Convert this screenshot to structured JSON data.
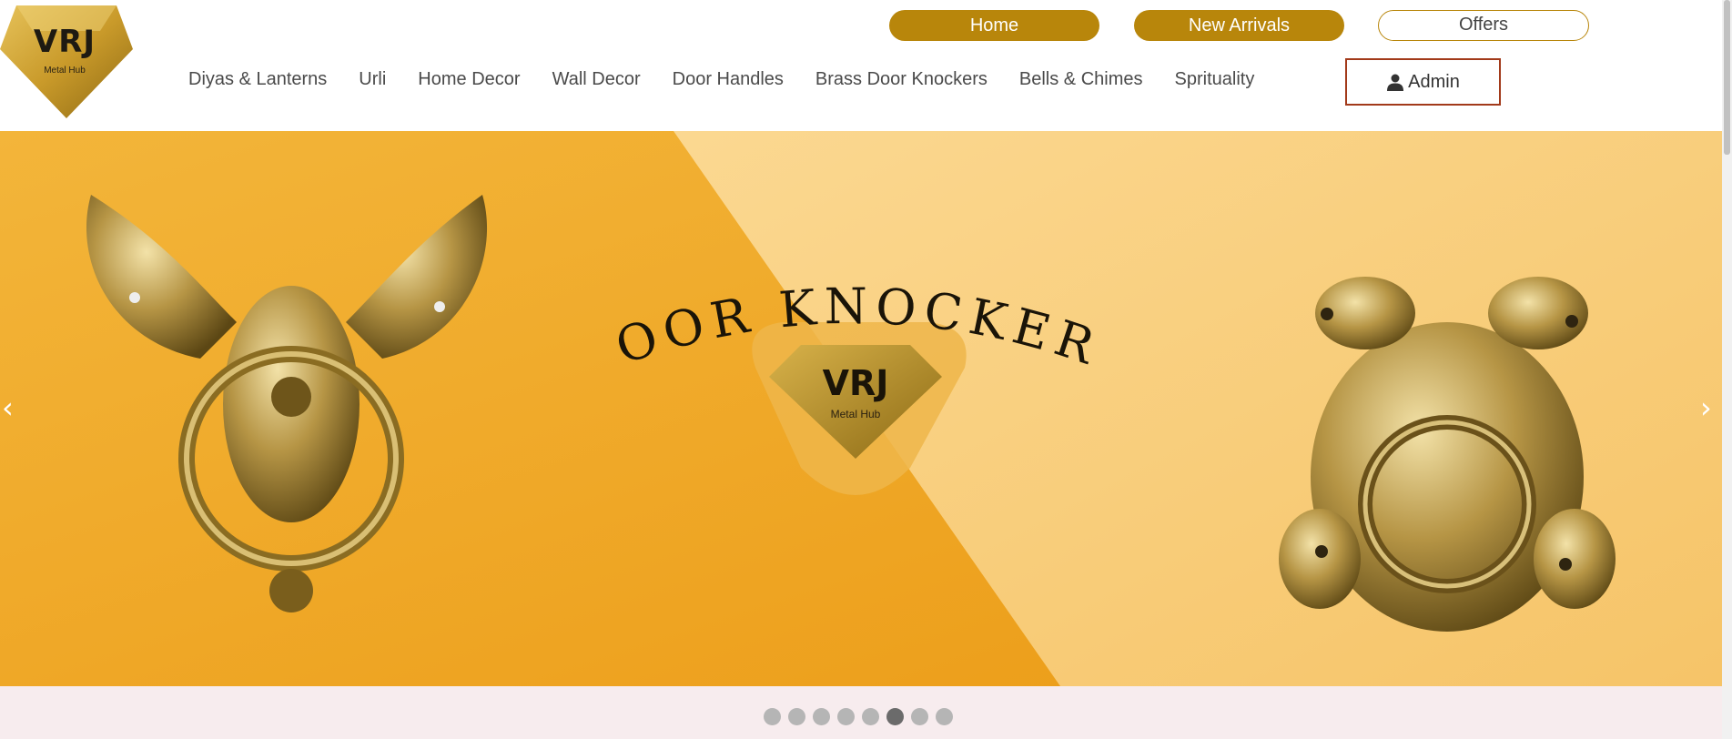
{
  "brand": {
    "logo_text": "VRJ",
    "logo_subtext": "Metal Hub",
    "color_gold": "#b8860b"
  },
  "top_buttons": {
    "home": "Home",
    "new_arrivals": "New Arrivals",
    "offers": "Offers"
  },
  "nav": {
    "items": [
      {
        "label": "Diyas & Lanterns"
      },
      {
        "label": "Urli"
      },
      {
        "label": "Home Decor"
      },
      {
        "label": "Wall Decor"
      },
      {
        "label": "Door Handles"
      },
      {
        "label": "Brass Door Knockers"
      },
      {
        "label": "Bells & Chimes"
      },
      {
        "label": "Sprituality"
      }
    ]
  },
  "admin": {
    "label": "Admin",
    "icon": "user-icon"
  },
  "banner": {
    "title": "DOOR KNOCKERS",
    "logo_text": "VRJ",
    "logo_subtext": "Metal Hub",
    "prev_icon": "chevron-left-icon",
    "next_icon": "chevron-right-icon",
    "prev_glyph": "‹",
    "next_glyph": "›"
  },
  "carousel": {
    "slide_count": 8,
    "active_index": 6
  }
}
